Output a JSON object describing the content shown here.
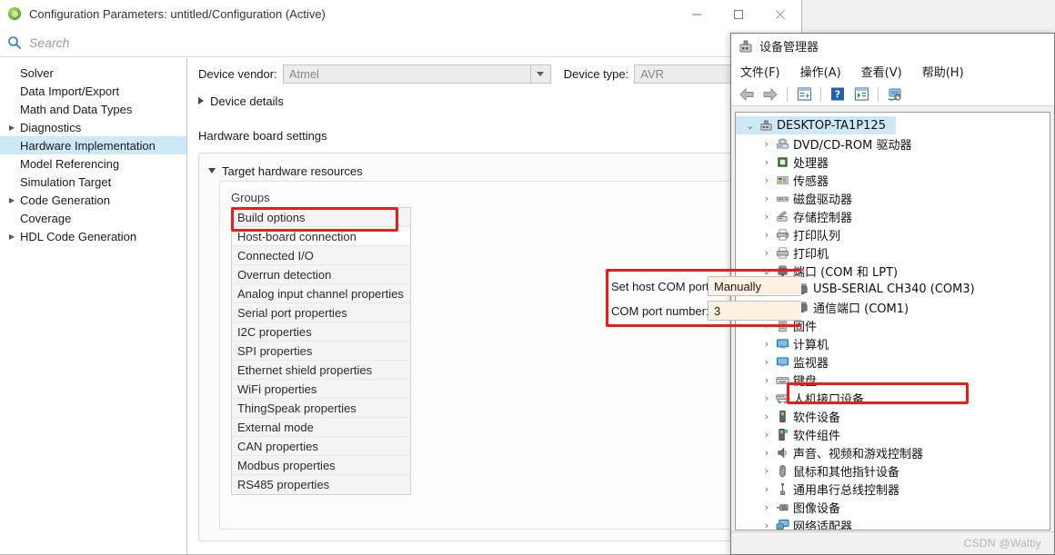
{
  "config_window": {
    "title": "Configuration Parameters: untitled/Configuration (Active)",
    "app_icon": "simulink-icon",
    "window_controls": {
      "minimize": "minimize-icon",
      "maximize": "maximize-icon",
      "close": "close-icon"
    },
    "search": {
      "icon": "search-icon",
      "placeholder": "Search",
      "value": ""
    },
    "tree": {
      "items": [
        {
          "label": "Solver",
          "expandable": false,
          "selected": false
        },
        {
          "label": "Data Import/Export",
          "expandable": false,
          "selected": false
        },
        {
          "label": "Math and Data Types",
          "expandable": false,
          "selected": false
        },
        {
          "label": "Diagnostics",
          "expandable": true,
          "selected": false
        },
        {
          "label": "Hardware Implementation",
          "expandable": false,
          "selected": true
        },
        {
          "label": "Model Referencing",
          "expandable": false,
          "selected": false
        },
        {
          "label": "Simulation Target",
          "expandable": false,
          "selected": false
        },
        {
          "label": "Code Generation",
          "expandable": true,
          "selected": false
        },
        {
          "label": "Coverage",
          "expandable": false,
          "selected": false
        },
        {
          "label": "HDL Code Generation",
          "expandable": true,
          "selected": false
        }
      ]
    },
    "device_vendor": {
      "label": "Device vendor:",
      "value": "Atmel"
    },
    "device_type": {
      "label": "Device type:",
      "value": "AVR"
    },
    "device_details": {
      "label": "Device details",
      "expanded": false
    },
    "hardware_board_settings_label": "Hardware board settings",
    "target_hardware_resources": {
      "label": "Target hardware resources",
      "expanded": true
    },
    "groups": {
      "label": "Groups",
      "items": [
        {
          "label": "Build options",
          "active": false
        },
        {
          "label": "Host-board connection",
          "active": true
        },
        {
          "label": "Connected I/O",
          "active": false
        },
        {
          "label": "Overrun detection",
          "active": false
        },
        {
          "label": "Analog input channel properties",
          "active": false
        },
        {
          "label": "Serial port properties",
          "active": false
        },
        {
          "label": "I2C properties",
          "active": false
        },
        {
          "label": "SPI properties",
          "active": false
        },
        {
          "label": "Ethernet shield properties",
          "active": false
        },
        {
          "label": "WiFi properties",
          "active": false
        },
        {
          "label": "ThingSpeak properties",
          "active": false
        },
        {
          "label": "External mode",
          "active": false
        },
        {
          "label": "CAN properties",
          "active": false
        },
        {
          "label": "Modbus properties",
          "active": false
        },
        {
          "label": "RS485 properties",
          "active": false
        }
      ]
    },
    "host_board_connection": {
      "set_host_com_port": {
        "label": "Set host COM port:",
        "value": "Manually"
      },
      "com_port_number": {
        "label": "COM port number:",
        "value": "3"
      }
    },
    "annotation_color": "#ee1c19",
    "highlight_color": "#cde8f7",
    "field_fill_color": "#fdf1e2"
  },
  "device_manager": {
    "title": "设备管理器",
    "title_icon": "device-manager-icon",
    "menus": [
      {
        "label": "文件(F)",
        "mnemonic": "F"
      },
      {
        "label": "操作(A)",
        "mnemonic": "A"
      },
      {
        "label": "查看(V)",
        "mnemonic": "V"
      },
      {
        "label": "帮助(H)",
        "mnemonic": "H"
      }
    ],
    "toolbar": [
      {
        "name": "back-icon"
      },
      {
        "name": "forward-icon"
      },
      {
        "name": "properties-icon"
      },
      {
        "name": "help-icon"
      },
      {
        "name": "scan-hardware-icon"
      },
      {
        "name": "show-hidden-devices-icon"
      }
    ],
    "tree": {
      "root": {
        "label": "DESKTOP-TA1P125",
        "icon": "computer-icon",
        "expanded": true,
        "selected": true
      },
      "nodes": [
        {
          "label": "DVD/CD-ROM 驱动器",
          "icon": "dvd-drive-icon",
          "expanded": false,
          "level": 1
        },
        {
          "label": "处理器",
          "icon": "processor-icon",
          "expanded": false,
          "level": 1
        },
        {
          "label": "传感器",
          "icon": "sensor-icon",
          "expanded": false,
          "level": 1
        },
        {
          "label": "磁盘驱动器",
          "icon": "disk-drive-icon",
          "expanded": false,
          "level": 1
        },
        {
          "label": "存储控制器",
          "icon": "storage-controller-icon",
          "expanded": false,
          "level": 1
        },
        {
          "label": "打印队列",
          "icon": "print-queue-icon",
          "expanded": false,
          "level": 1
        },
        {
          "label": "打印机",
          "icon": "printer-icon",
          "expanded": false,
          "level": 1
        },
        {
          "label": "端口 (COM 和 LPT)",
          "icon": "port-icon",
          "expanded": true,
          "level": 1
        },
        {
          "label": "USB-SERIAL CH340 (COM3)",
          "icon": "port-icon",
          "expanded": null,
          "level": 2,
          "highlighted": true
        },
        {
          "label": "通信端口 (COM1)",
          "icon": "port-icon",
          "expanded": null,
          "level": 2
        },
        {
          "label": "固件",
          "icon": "firmware-icon",
          "expanded": false,
          "level": 1
        },
        {
          "label": "计算机",
          "icon": "computer-node-icon",
          "expanded": false,
          "level": 1
        },
        {
          "label": "监视器",
          "icon": "monitor-icon",
          "expanded": false,
          "level": 1
        },
        {
          "label": "键盘",
          "icon": "keyboard-icon",
          "expanded": false,
          "level": 1
        },
        {
          "label": "人机接口设备",
          "icon": "hid-icon",
          "expanded": false,
          "level": 1
        },
        {
          "label": "软件设备",
          "icon": "software-device-icon",
          "expanded": false,
          "level": 1
        },
        {
          "label": "软件组件",
          "icon": "software-component-icon",
          "expanded": false,
          "level": 1
        },
        {
          "label": "声音、视频和游戏控制器",
          "icon": "audio-icon",
          "expanded": false,
          "level": 1
        },
        {
          "label": "鼠标和其他指针设备",
          "icon": "mouse-icon",
          "expanded": false,
          "level": 1
        },
        {
          "label": "通用串行总线控制器",
          "icon": "usb-controller-icon",
          "expanded": false,
          "level": 1
        },
        {
          "label": "图像设备",
          "icon": "imaging-device-icon",
          "expanded": false,
          "level": 1
        },
        {
          "label": "网络适配器",
          "icon": "network-adapter-icon",
          "expanded": false,
          "level": 1
        }
      ]
    },
    "status_watermark": "CSDN @Waltiy"
  }
}
